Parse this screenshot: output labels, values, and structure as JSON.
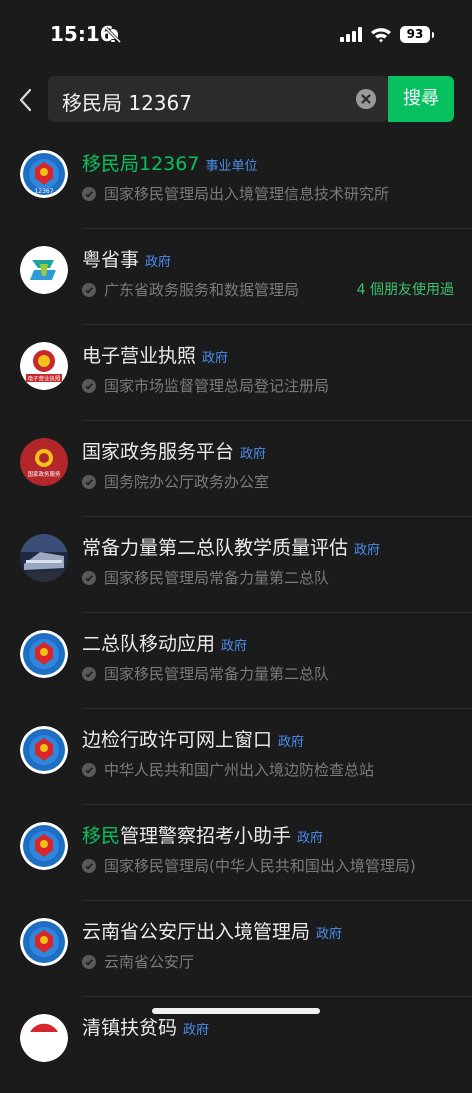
{
  "status": {
    "time": "15:16",
    "battery": "93"
  },
  "search": {
    "query": "移民局 12367",
    "button": "搜尋"
  },
  "results": [
    {
      "title_hl": "移民局12367",
      "title_rest": "",
      "tag": "事业单位",
      "subtitle": "国家移民管理局出入境管理信息技术研究所",
      "friends": ""
    },
    {
      "title_hl": "",
      "title_rest": "粤省事",
      "tag": "政府",
      "subtitle": "广东省政务服务和数据管理局",
      "friends": "4 個朋友使用過"
    },
    {
      "title_hl": "",
      "title_rest": "电子营业执照",
      "tag": "政府",
      "subtitle": "国家市场监督管理总局登记注册局",
      "friends": ""
    },
    {
      "title_hl": "",
      "title_rest": "国家政务服务平台",
      "tag": "政府",
      "subtitle": "国务院办公厅政务办公室",
      "friends": ""
    },
    {
      "title_hl": "",
      "title_rest": "常备力量第二总队教学质量评估",
      "tag": "政府",
      "subtitle": "国家移民管理局常备力量第二总队",
      "friends": ""
    },
    {
      "title_hl": "",
      "title_rest": "二总队移动应用",
      "tag": "政府",
      "subtitle": "国家移民管理局常备力量第二总队",
      "friends": ""
    },
    {
      "title_hl": "",
      "title_rest": "边检行政许可网上窗口",
      "tag": "政府",
      "subtitle": "中华人民共和国广州出入境边防检查总站",
      "friends": ""
    },
    {
      "title_hl": "移民",
      "title_rest": "管理警察招考小助手",
      "tag": "政府",
      "subtitle": "国家移民管理局(中华人民共和国出入境管理局)",
      "friends": ""
    },
    {
      "title_hl": "",
      "title_rest": "云南省公安厅出入境管理局",
      "tag": "政府",
      "subtitle": "云南省公安厅",
      "friends": ""
    },
    {
      "title_hl": "",
      "title_rest": "清镇扶贫码",
      "tag": "政府",
      "subtitle": "",
      "friends": ""
    }
  ],
  "avatar_labels": {
    "immigration": "12367",
    "license": "电子营业执照",
    "govservice": "国家政务服务"
  },
  "colors": {
    "accent": "#07c160",
    "tag": "#4a8ef0",
    "background": "#1b1b1b"
  }
}
